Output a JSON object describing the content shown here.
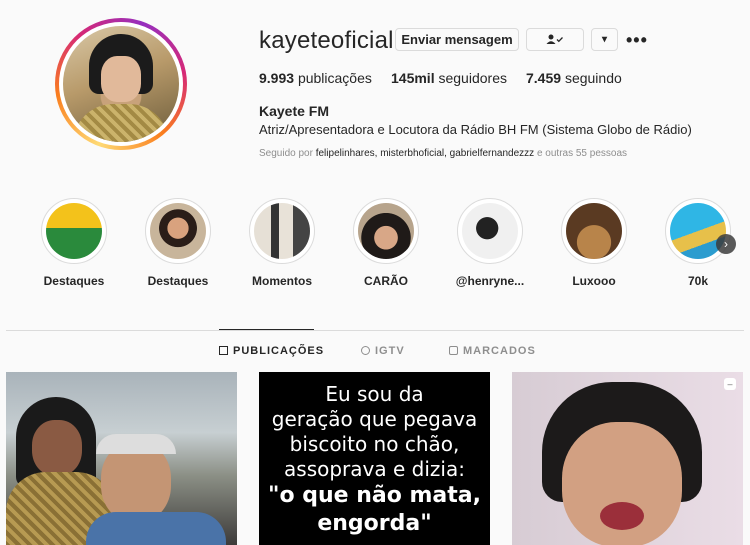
{
  "profile": {
    "username": "kayeteoficial",
    "message_button": "Enviar mensagem",
    "follow_icon": "person-check-icon",
    "dropdown_icon": "▾",
    "more_icon": "•••",
    "stats": {
      "posts_value": "9.993",
      "posts_label": "publicações",
      "followers_value": "145mil",
      "followers_label": "seguidores",
      "following_value": "7.459",
      "following_label": "seguindo"
    },
    "full_name": "Kayete FM",
    "bio": "Atriz/Apresentadora e Locutora da Rádio BH FM (Sistema Globo de Rádio)",
    "followed_by_prefix": "Seguido por",
    "followed_by_names": "felipelinhares, misterbhoficial, gabrielfernandezzz",
    "followed_by_suffix": "e outras 55 pessoas"
  },
  "highlights": [
    {
      "label": "Destaques"
    },
    {
      "label": "Destaques"
    },
    {
      "label": "Momentos"
    },
    {
      "label": "CARÃO"
    },
    {
      "label": "@henryne..."
    },
    {
      "label": "Luxooo"
    },
    {
      "label": "70k"
    }
  ],
  "highlight_next_icon": "›",
  "tabs": [
    {
      "label": "PUBLICAÇÕES",
      "icon": "grid-icon"
    },
    {
      "label": "IGTV",
      "icon": "igtv-icon"
    },
    {
      "label": "MARCADOS",
      "icon": "tagged-icon"
    }
  ],
  "posts": {
    "quote_lines": [
      "Eu sou da",
      "geração que pegava",
      "biscoito no chão,",
      "assoprava e dizia:"
    ],
    "quote_bold_lines": [
      "\"o que não mata,",
      "engorda\""
    ],
    "post3_badge_icon": "‒"
  },
  "colors": {
    "story_ring": "#d62976",
    "text": "#262626",
    "muted": "#8e8e8e",
    "border": "#dbdbdb"
  }
}
